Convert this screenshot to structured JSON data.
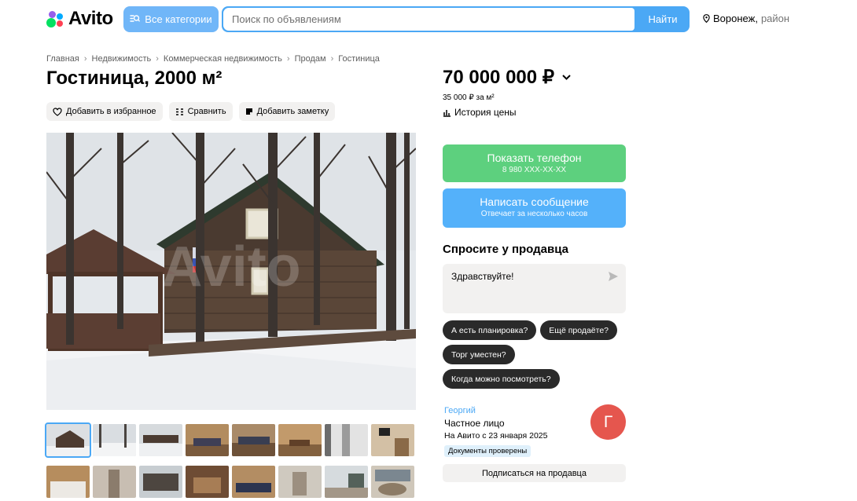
{
  "header": {
    "logo_text": "Avito",
    "categories_label": "Все категории",
    "search_placeholder": "Поиск по объявлениям",
    "search_button": "Найти",
    "location_city": "Воронеж,",
    "location_sub": "район"
  },
  "breadcrumb": [
    "Главная",
    "Недвижимость",
    "Коммерческая недвижимость",
    "Продам",
    "Гостиница"
  ],
  "listing": {
    "title": "Гостиница, 2000 м²",
    "actions": {
      "favorite": "Добавить в избранное",
      "compare": "Сравнить",
      "note": "Добавить заметку"
    },
    "watermark": "Avito"
  },
  "price": {
    "value": "70 000 000 ₽",
    "per_meter": "35 000 ₽ за м²",
    "history": "История цены"
  },
  "contact": {
    "phone_label": "Показать телефон",
    "phone_masked": "8 980 XXX-XX-XX",
    "message_label": "Написать сообщение",
    "message_sub": "Отвечает за несколько часов"
  },
  "ask": {
    "title": "Спросите у продавца",
    "message": "Здравствуйте!",
    "chips": [
      "А есть планировка?",
      "Ещё продаёте?",
      "Торг уместен?",
      "Когда можно посмотреть?"
    ]
  },
  "seller": {
    "name": "Георгий",
    "type": "Частное лицо",
    "since": "На Авито с 23 января 2025",
    "verified": "Документы проверены",
    "avatar_letter": "Г",
    "subscribe": "Подписаться на продавца"
  },
  "colors": {
    "accent_blue": "#4ba8f5",
    "phone_green": "#5dd07e",
    "avatar_red": "#e5564e"
  }
}
